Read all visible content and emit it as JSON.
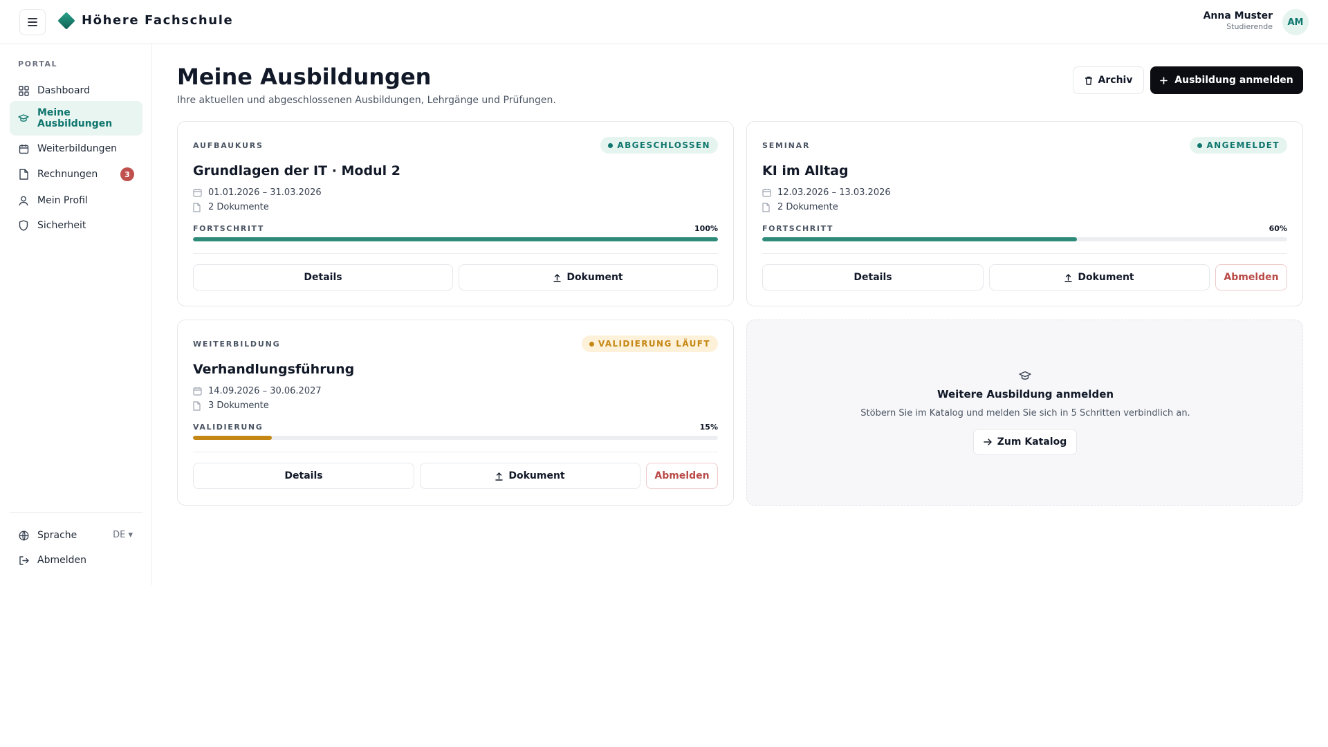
{
  "header": {
    "brand": "Höhere Fachschule",
    "user_name": "Anna Muster",
    "user_role": "Studierende",
    "avatar_initials": "AM"
  },
  "sidebar": {
    "section_label": "PORTAL",
    "items": [
      {
        "label": "Dashboard",
        "icon": "grid-icon"
      },
      {
        "label": "Meine Ausbildungen",
        "icon": "graduation-cap-icon",
        "active": true
      },
      {
        "label": "Weiterbildungen",
        "icon": "calendar-icon"
      },
      {
        "label": "Rechnungen",
        "icon": "document-icon",
        "badge": "3"
      },
      {
        "label": "Mein Profil",
        "icon": "user-icon"
      },
      {
        "label": "Sicherheit",
        "icon": "shield-icon"
      }
    ],
    "footer": {
      "language_label": "Sprache",
      "language_value": "DE ▾",
      "logout_label": "Abmelden"
    }
  },
  "main": {
    "title": "Meine Ausbildungen",
    "subtitle": "Ihre aktuellen und abgeschlossenen Ausbildungen, Lehrgänge und Prüfungen.",
    "archive_label": "Archiv",
    "enroll_label": "Ausbildung anmelden",
    "cards": [
      {
        "type": "AUFBAUKURS",
        "status": "ABGESCHLOSSEN",
        "title": "Grundlagen der IT · Modul 2",
        "dates": "01.01.2026 – 31.03.2026",
        "documents": "2 Dokumente",
        "progress_label": "FORTSCHRITT",
        "progress_text": "100%",
        "progress": 1.0,
        "details_label": "Details",
        "document_label": "Dokument"
      },
      {
        "type": "SEMINAR",
        "status": "ANGEMELDET",
        "title": "KI im Alltag",
        "dates": "12.03.2026 – 13.03.2026",
        "documents": "2 Dokumente",
        "progress_label": "FORTSCHRITT",
        "progress_text": "60%",
        "progress": 0.6,
        "details_label": "Details",
        "document_label": "Dokument",
        "cancel_label": "Abmelden"
      },
      {
        "type": "WEITERBILDUNG",
        "status": "VALIDIERUNG LÄUFT",
        "title": "Verhandlungsführung",
        "dates": "14.09.2026 – 30.06.2027",
        "documents": "3 Dokumente",
        "progress_label": "VALIDIERUNG",
        "progress_text": "15%",
        "progress": 0.15,
        "details_label": "Details",
        "document_label": "Dokument",
        "cancel_label": "Abmelden"
      }
    ],
    "promo": {
      "title": "Weitere Ausbildung anmelden",
      "text": "Stöbern Sie im Katalog und melden Sie sich in 5 Schritten verbindlich an.",
      "button_label": "Zum Katalog"
    }
  },
  "colors": {
    "accent": "#0f766e",
    "progress_teal": "#2e8b7a",
    "progress_amber": "#c58714",
    "danger": "#b94a48",
    "primary_button": "#0b0d12"
  }
}
